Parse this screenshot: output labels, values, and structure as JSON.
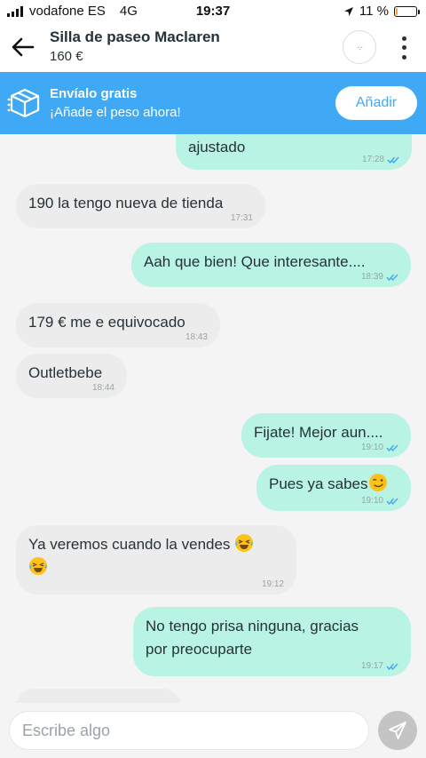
{
  "status_bar": {
    "carrier": "vodafone ES",
    "network": "4G",
    "time": "19:37",
    "battery_text": "11 %",
    "battery_level": 0.11,
    "battery_color": "#f5a623"
  },
  "header": {
    "title": "Silla de paseo Maclaren",
    "price": "160 €",
    "back_icon": "arrow-left-icon",
    "avatar_face": "-.-",
    "more_icon": "more-vertical-icon"
  },
  "shipping_banner": {
    "title": "Envíalo gratis",
    "subtitle": "¡Añade el peso ahora!",
    "button_label": "Añadir",
    "icon": "package-icon",
    "background": "#3fa9f5"
  },
  "messages": [
    {
      "direction": "out",
      "text": "ajustado",
      "time": "17:28",
      "read": true
    },
    {
      "direction": "in",
      "text": "190 la tengo nueva de tienda",
      "time": "17:31"
    },
    {
      "direction": "out",
      "text": "Aah que bien! Que interesante....",
      "time": "18:39",
      "read": true
    },
    {
      "direction": "in",
      "text": "179 € me e equivocado",
      "time": "18:43"
    },
    {
      "direction": "in",
      "text": "Outletbebe",
      "time": "18:44"
    },
    {
      "direction": "out",
      "text": "Fijate! Mejor aun....",
      "time": "19:10",
      "read": true
    },
    {
      "direction": "out",
      "text": "Pues ya sabes",
      "emoji": "winking-face",
      "time": "19:10",
      "read": true
    },
    {
      "direction": "in",
      "text": "Ya veremos cuando la vendes",
      "emoji": "laughing-tears-face",
      "emoji_count": 2,
      "time": "19:12"
    },
    {
      "direction": "out",
      "text": "No tengo prisa ninguna, gracias\npor preocuparte",
      "time": "19:17",
      "read": true
    }
  ],
  "composer": {
    "placeholder": "Escribe algo",
    "value": "",
    "send_icon": "send-icon"
  },
  "colors": {
    "incoming_bubble": "#ececec",
    "outgoing_bubble": "#b9f3e4",
    "read_ticks": "#3fa9f5"
  }
}
